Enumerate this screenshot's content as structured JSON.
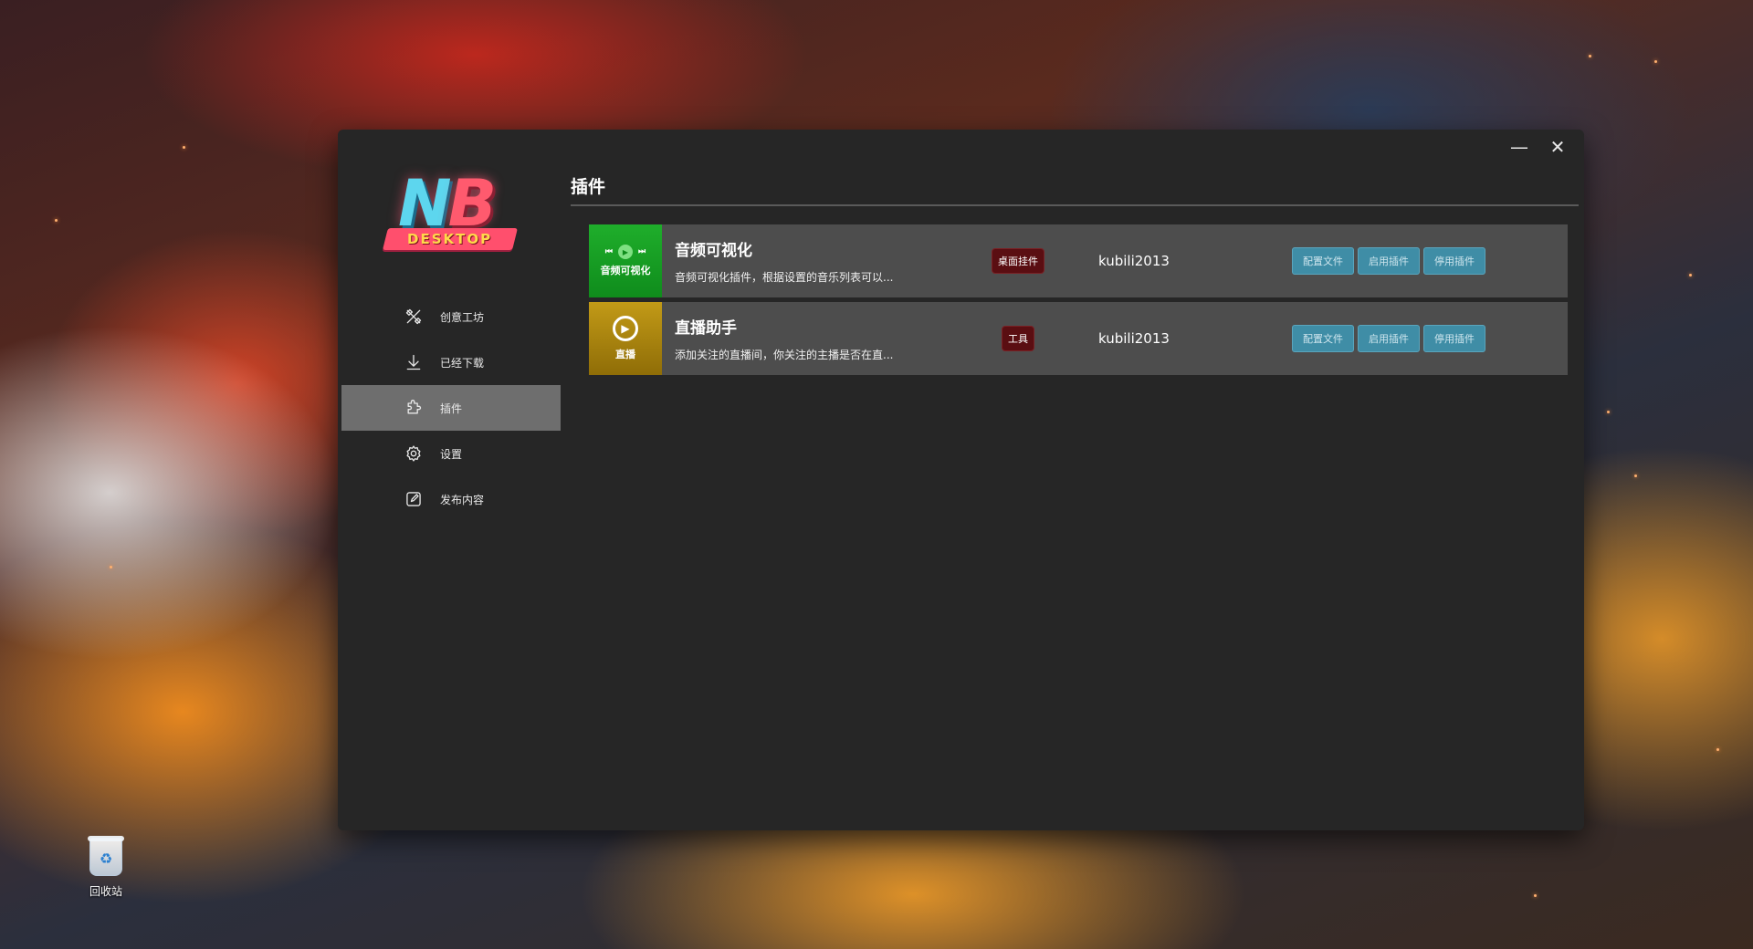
{
  "desktop": {
    "recycle_bin_label": "回收站"
  },
  "window": {
    "minimize_glyph": "—",
    "close_glyph": "✕"
  },
  "logo": {
    "text_main": "NB",
    "text_banner": "DESKTOP"
  },
  "sidebar": {
    "items": [
      {
        "label": "创意工坊",
        "icon": "tools-icon"
      },
      {
        "label": "已经下载",
        "icon": "download-icon"
      },
      {
        "label": "插件",
        "icon": "puzzle-icon",
        "active": true
      },
      {
        "label": "设置",
        "icon": "gear-icon"
      },
      {
        "label": "发布内容",
        "icon": "edit-icon"
      }
    ]
  },
  "main": {
    "title": "插件",
    "plugins": [
      {
        "thumb_label": "音频可视化",
        "thumb_color": "#1fae2b",
        "name": "音频可视化",
        "description": "音频可视化插件，根据设置的音乐列表可以...",
        "tag": "桌面挂件",
        "author": "kubili2013",
        "actions": [
          "配置文件",
          "启用插件",
          "停用插件"
        ]
      },
      {
        "thumb_label": "直播",
        "thumb_color": "#c29a17",
        "name": "直播助手",
        "description": "添加关注的直播间，你关注的主播是否在直...",
        "tag": "工具",
        "author": "kubili2013",
        "actions": [
          "配置文件",
          "启用插件",
          "停用插件"
        ]
      }
    ]
  }
}
